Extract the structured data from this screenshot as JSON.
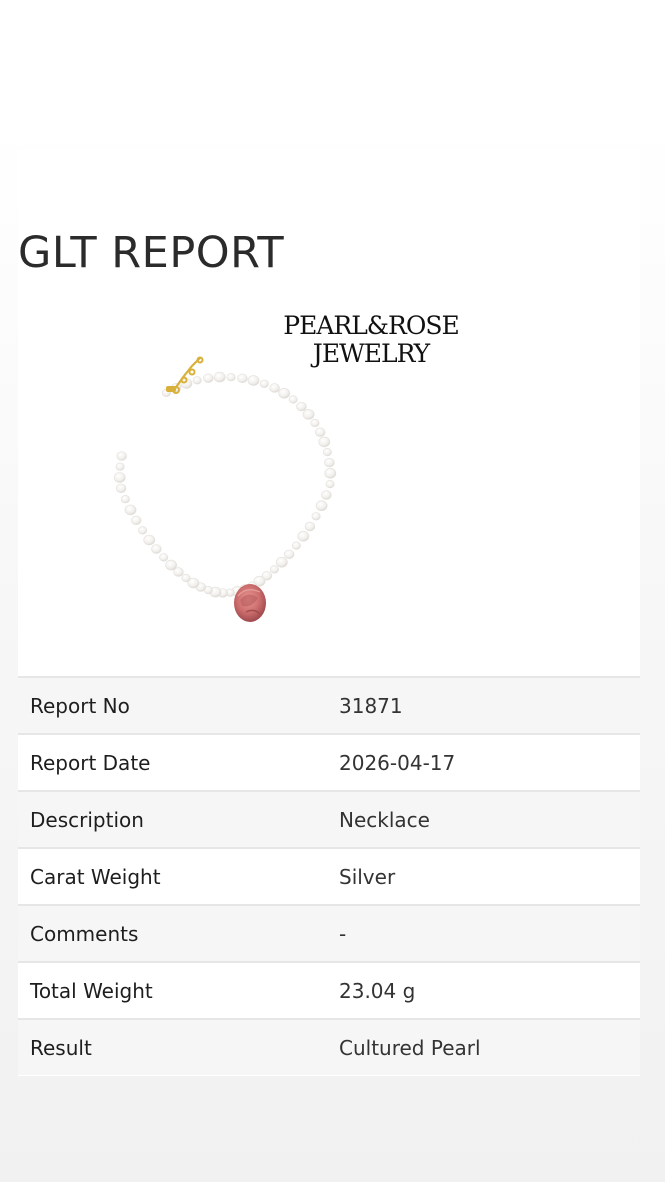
{
  "report": {
    "title": "GLT REPORT",
    "brand_line1": "PEARL&ROSE",
    "brand_line2": "JEWELRY",
    "image_label": "pearl necklace with rose pendant",
    "rows": [
      {
        "label": "Report No",
        "value": "31871"
      },
      {
        "label": "Report Date",
        "value": "2026-04-17"
      },
      {
        "label": "Description",
        "value": "Necklace"
      },
      {
        "label": "Carat Weight",
        "value": "Silver"
      },
      {
        "label": "Comments",
        "value": "-"
      },
      {
        "label": "Total Weight",
        "value": "23.04 g"
      },
      {
        "label": "Result",
        "value": "Cultured Pearl"
      }
    ]
  },
  "colors": {
    "pearl": "#f4f2ef",
    "gold": "#d9b13a",
    "rose": "#c96a6a"
  }
}
